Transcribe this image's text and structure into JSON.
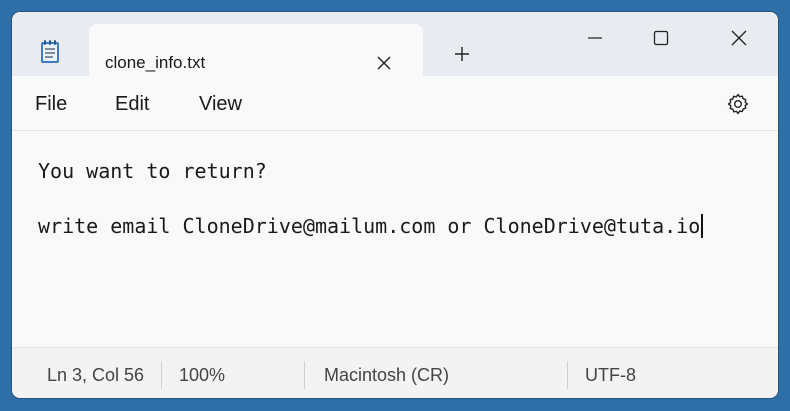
{
  "tab": {
    "title": "clone_info.txt"
  },
  "menu": {
    "file": "File",
    "edit": "Edit",
    "view": "View"
  },
  "document": {
    "lines": [
      "You want to return?",
      "write email CloneDrive@mailum.com or CloneDrive@tuta.io"
    ]
  },
  "status": {
    "position": "Ln 3, Col 56",
    "zoom": "100%",
    "line_endings": "Macintosh (CR)",
    "encoding": "UTF-8"
  },
  "icons": {
    "app": "notepad-icon",
    "tab_close": "close-icon",
    "new_tab": "plus-icon",
    "minimize": "minimize-icon",
    "maximize": "maximize-icon",
    "close": "close-icon",
    "settings": "gear-icon"
  },
  "colors": {
    "background": "#2f6fa8",
    "titlebar": "#e8ecf1",
    "editor": "#f9f9f9",
    "text": "#1a1a1a"
  }
}
